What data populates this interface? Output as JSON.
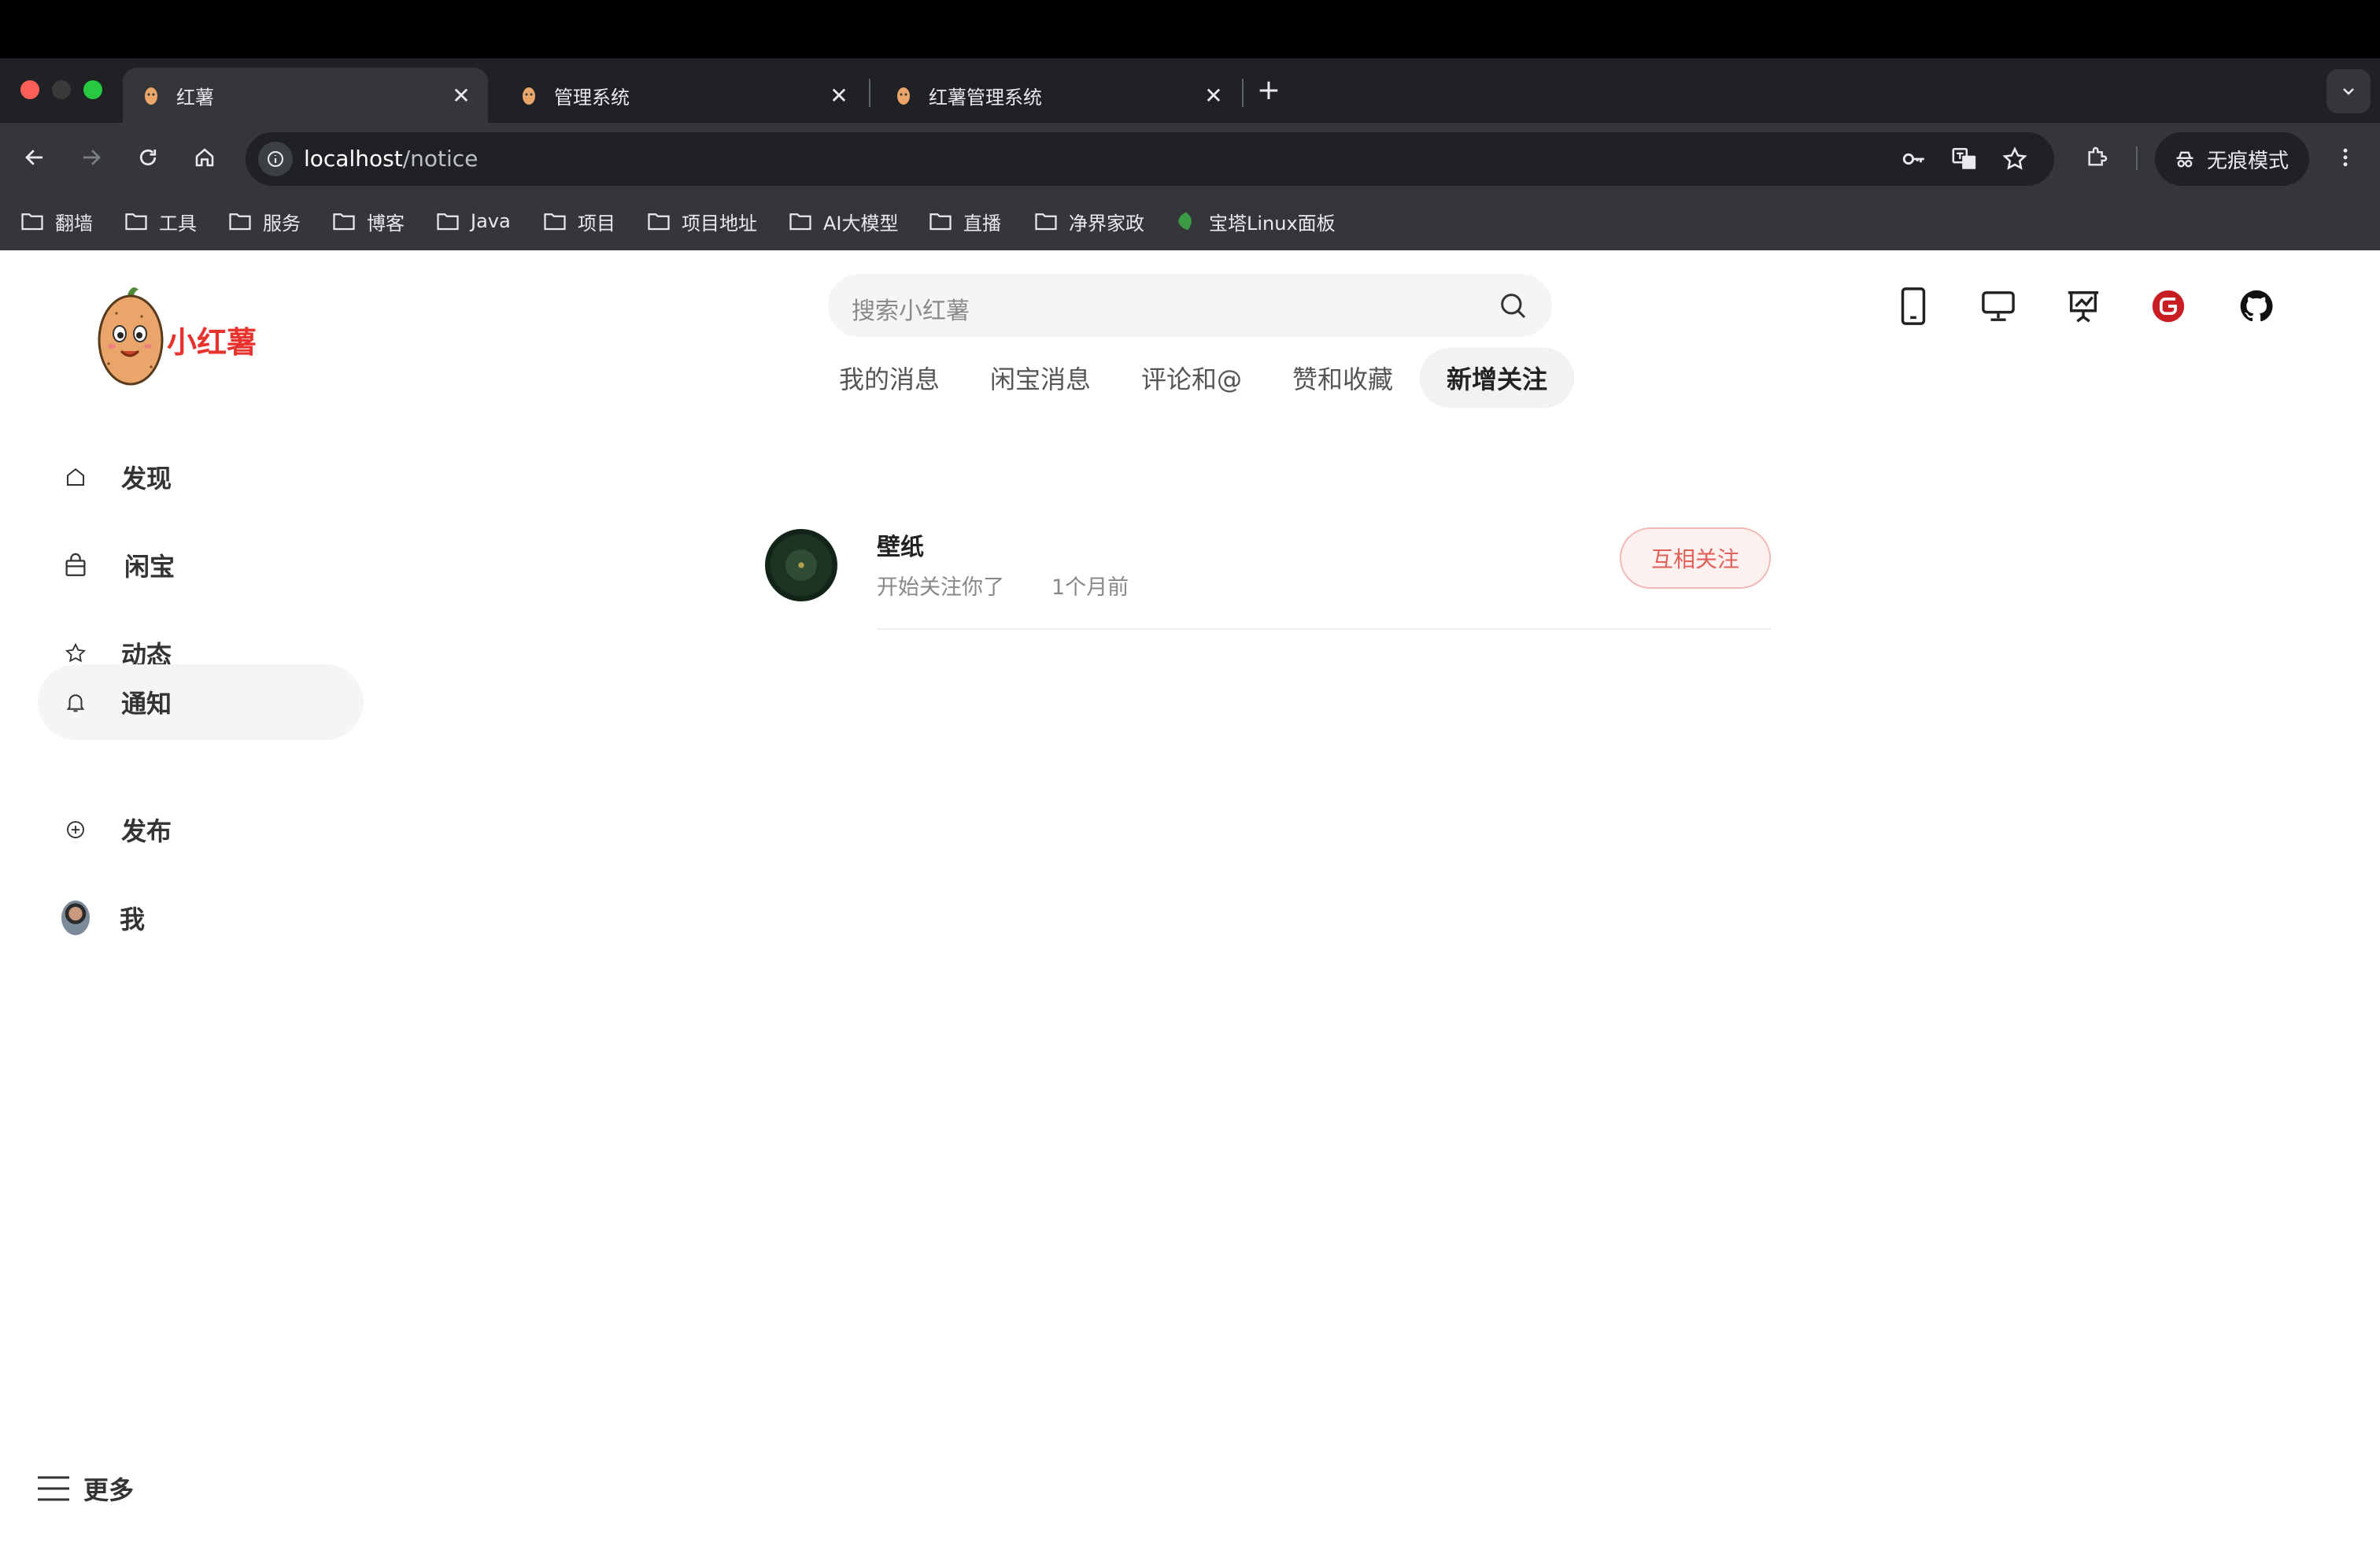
{
  "browser": {
    "tabs": [
      {
        "title": "红薯",
        "active": true
      },
      {
        "title": "管理系统",
        "active": false
      },
      {
        "title": "红薯管理系统",
        "active": false
      }
    ],
    "close_glyph": "✕",
    "newtab_glyph": "+",
    "url_host": "localhost",
    "url_path": "/notice",
    "incognito_label": "无痕模式",
    "bookmarks": [
      "翻墙",
      "工具",
      "服务",
      "博客",
      "Java",
      "项目",
      "项目地址",
      "AI大模型",
      "直播",
      "净界家政",
      "宝塔Linux面板"
    ],
    "traffic_colors": [
      "#ff5f57",
      "#3a3a3a",
      "#28c840"
    ]
  },
  "app": {
    "logo_text": "小红薯",
    "search_placeholder": "搜索小红薯",
    "sidebar": {
      "items": [
        {
          "label": "发现",
          "icon": "home-icon",
          "active": false
        },
        {
          "label": "闲宝",
          "icon": "shopping-bag-icon",
          "active": false
        },
        {
          "label": "动态",
          "icon": "star-icon",
          "active": false
        },
        {
          "label": "通知",
          "icon": "bell-icon",
          "active": true
        },
        {
          "label": "发布",
          "icon": "plus-circle-icon",
          "active": false
        },
        {
          "label": "我",
          "icon": "avatar",
          "active": false
        }
      ],
      "more_label": "更多"
    },
    "top_icons": [
      "tablet-icon",
      "monitor-icon",
      "presentation-icon",
      "gitee-icon",
      "github-icon"
    ],
    "notice_tabs": [
      {
        "label": "我的消息",
        "active": false
      },
      {
        "label": "闲宝消息",
        "active": false
      },
      {
        "label": "评论和@",
        "active": false
      },
      {
        "label": "赞和收藏",
        "active": false
      },
      {
        "label": "新增关注",
        "active": true
      }
    ],
    "notices": [
      {
        "name": "壁纸",
        "action": "开始关注你了",
        "time": "1个月前",
        "button": "互相关注"
      }
    ],
    "colors": {
      "brand": "#e8322d",
      "follow_button": "#e0605a",
      "gitee": "#c71d23"
    }
  }
}
